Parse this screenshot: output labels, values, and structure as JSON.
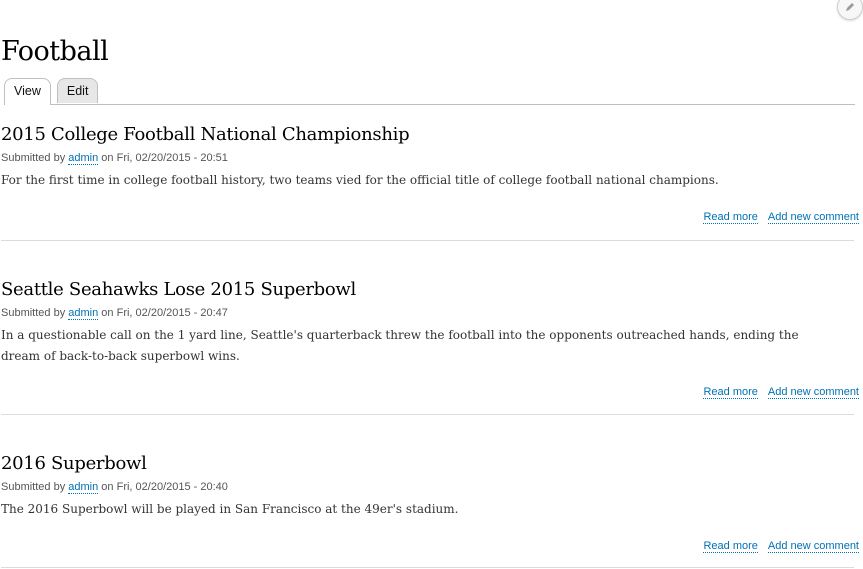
{
  "page": {
    "title": "Football"
  },
  "tabs": [
    {
      "label": "View",
      "active": true
    },
    {
      "label": "Edit",
      "active": false
    }
  ],
  "meta_labels": {
    "submitted_by": "Submitted by",
    "on": "on"
  },
  "links": {
    "read_more": "Read more",
    "add_comment": "Add new comment"
  },
  "articles": [
    {
      "title": "2015 College Football National Championship",
      "author": "admin",
      "date": "Fri, 02/20/2015 - 20:51",
      "body": "For the first time in college football history, two teams vied for the official title of college football national champions."
    },
    {
      "title": "Seattle Seahawks Lose 2015 Superbowl",
      "author": "admin",
      "date": "Fri, 02/20/2015 - 20:47",
      "body": "In a questionable call on the 1 yard line, Seattle's quarterback threw the football into the opponents outreached hands, ending the dream of back-to-back superbowl wins."
    },
    {
      "title": "2016 Superbowl",
      "author": "admin",
      "date": "Fri, 02/20/2015 - 20:40",
      "body": "The 2016 Superbowl will be played in San Francisco at the 49er's stadium."
    }
  ],
  "icons": {
    "edit": "pencil-icon"
  },
  "colors": {
    "link": "#0071b3",
    "title": "#000000"
  }
}
